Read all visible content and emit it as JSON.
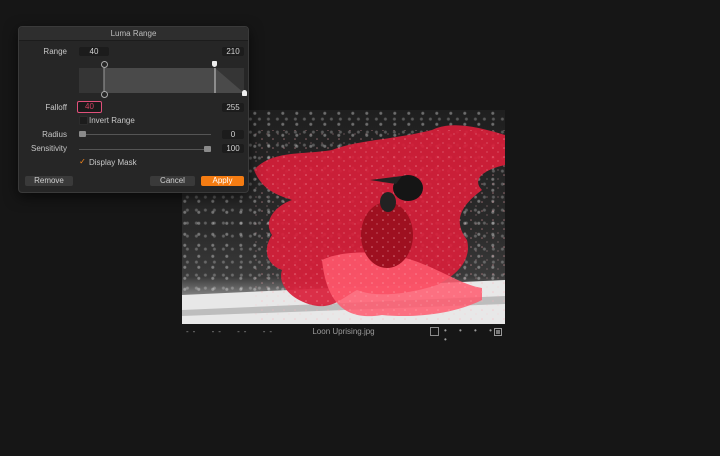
{
  "panel": {
    "title": "Luma Range",
    "range_label": "Range",
    "range_low": "40",
    "range_high": "210",
    "falloff_label": "Falloff",
    "falloff_low": "40",
    "falloff_high": "255",
    "invert_label": "Invert Range",
    "invert_checked": false,
    "radius_label": "Radius",
    "radius_value": "0",
    "radius_level": 0.0,
    "sensitivity_label": "Sensitivity",
    "sensitivity_value": "100",
    "sensitivity_level": 1.0,
    "display_mask_label": "Display Mask",
    "display_mask_checked": true,
    "remove_label": "Remove",
    "cancel_label": "Cancel",
    "apply_label": "Apply"
  },
  "status": {
    "placeholders": [
      "--",
      "--",
      "--",
      "--"
    ],
    "filename": "Loon Uprising.jpg",
    "dots": "• • • • •"
  },
  "colors": {
    "accent": "#f57c12",
    "mask": "#d81e3a",
    "falloff_border": "#e0507a"
  }
}
